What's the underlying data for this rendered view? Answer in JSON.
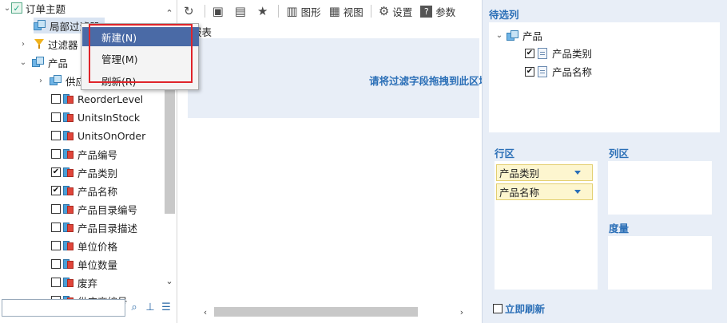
{
  "tree": {
    "root": "订单主题",
    "local_filter": "局部过滤器",
    "filter": "过滤器",
    "product": "产品",
    "supplier": "供应商",
    "fields": [
      {
        "label": "ReorderLevel",
        "checked": false
      },
      {
        "label": "UnitsInStock",
        "checked": false
      },
      {
        "label": "UnitsOnOrder",
        "checked": false
      },
      {
        "label": "产品编号",
        "checked": false
      },
      {
        "label": "产品类别",
        "checked": true
      },
      {
        "label": "产品名称",
        "checked": true
      },
      {
        "label": "产品目录编号",
        "checked": false
      },
      {
        "label": "产品目录描述",
        "checked": false
      },
      {
        "label": "单位价格",
        "checked": false
      },
      {
        "label": "单位数量",
        "checked": false
      },
      {
        "label": "废弃",
        "checked": false
      },
      {
        "label": "供应商编号",
        "checked": false
      }
    ],
    "check_mark": "✔"
  },
  "context_menu": {
    "items": [
      "新建(N)",
      "管理(M)",
      "刷新(R)"
    ]
  },
  "toolbar": {
    "chart_label": "图形",
    "view_label": "视图",
    "settings_label": "设置",
    "params_label": "参数"
  },
  "report": {
    "tab_label": "报表",
    "drop_hint": "请将过滤字段拖拽到此区域"
  },
  "right_panel": {
    "pending_title": "待选列",
    "product_node": "产品",
    "pending_fields": [
      "产品类别",
      "产品名称"
    ],
    "row_area_title": "行区",
    "column_area_title": "列区",
    "measure_title": "度量",
    "row_fields": [
      "产品类别",
      "产品名称"
    ],
    "auto_refresh_label": "立即刷新"
  },
  "colors": {
    "accent_blue": "#2b6fb7",
    "menu_highlight": "#4a6aa6",
    "annotation_red": "#e0242a",
    "drop_field_bg": "#fdf6cf"
  }
}
